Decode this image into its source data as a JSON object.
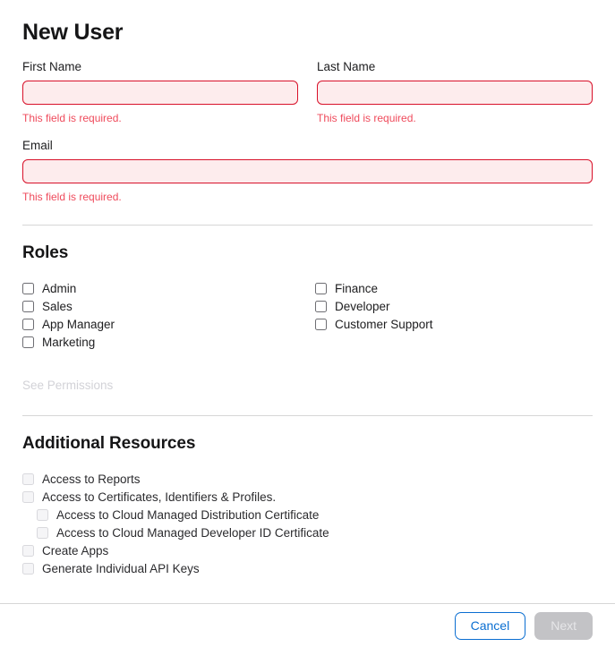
{
  "page": {
    "title": "New User"
  },
  "form": {
    "fields": [
      {
        "label": "First Name",
        "value": "",
        "placeholder": "",
        "error": "This field is required."
      },
      {
        "label": "Last Name",
        "value": "",
        "placeholder": "",
        "error": "This field is required."
      },
      {
        "label": "Email",
        "value": "",
        "placeholder": "",
        "error": "This field is required."
      }
    ]
  },
  "roles": {
    "heading": "Roles",
    "column_left": [
      {
        "label": "Admin",
        "checked": false
      },
      {
        "label": "Sales",
        "checked": false
      },
      {
        "label": "App Manager",
        "checked": false
      },
      {
        "label": "Marketing",
        "checked": false
      }
    ],
    "column_right": [
      {
        "label": "Finance",
        "checked": false
      },
      {
        "label": "Developer",
        "checked": false
      },
      {
        "label": "Customer Support",
        "checked": false
      }
    ],
    "see_permissions_label": "See Permissions"
  },
  "additional_resources": {
    "heading": "Additional Resources",
    "items": [
      {
        "label": "Access to Reports",
        "checked": false,
        "disabled": true,
        "indent": 0
      },
      {
        "label": "Access to Certificates, Identifiers & Profiles.",
        "checked": false,
        "disabled": true,
        "indent": 0
      },
      {
        "label": "Access to Cloud Managed Distribution Certificate",
        "checked": false,
        "disabled": true,
        "indent": 1
      },
      {
        "label": "Access to Cloud Managed Developer ID Certificate",
        "checked": false,
        "disabled": true,
        "indent": 1
      },
      {
        "label": "Create Apps",
        "checked": false,
        "disabled": true,
        "indent": 0
      },
      {
        "label": "Generate Individual API Keys",
        "checked": false,
        "disabled": true,
        "indent": 0
      }
    ]
  },
  "footer": {
    "cancel_label": "Cancel",
    "next_label": "Next",
    "next_disabled": true
  },
  "colors": {
    "error_border": "#d8112a",
    "error_fill": "#fdeced",
    "error_text": "#ef4b5c",
    "accent_blue": "#0a6ed1",
    "disabled_grey": "#c3c3c6",
    "divider": "#d6d6d6"
  }
}
